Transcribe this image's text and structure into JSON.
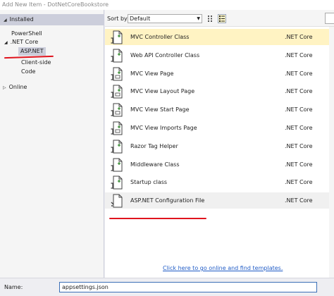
{
  "window": {
    "title": "Add New Item - DotNetCoreBookstore"
  },
  "tree": {
    "installed_label": "Installed",
    "items": [
      "PowerShell",
      ".NET Core",
      "ASP.NET",
      "Client-side",
      "Code"
    ],
    "online_label": "Online"
  },
  "toolbar": {
    "sort_by_label": "Sort by:",
    "sort_value": "Default"
  },
  "templates": [
    {
      "name": "MVC Controller Class",
      "lang": ".NET Core"
    },
    {
      "name": "Web API Controller Class",
      "lang": ".NET Core"
    },
    {
      "name": "MVC View Page",
      "lang": ".NET Core"
    },
    {
      "name": "MVC View Layout Page",
      "lang": ".NET Core"
    },
    {
      "name": "MVC View Start Page",
      "lang": ".NET Core"
    },
    {
      "name": "MVC View Imports Page",
      "lang": ".NET Core"
    },
    {
      "name": "Razor Tag Helper",
      "lang": ".NET Core"
    },
    {
      "name": "Middleware Class",
      "lang": ".NET Core"
    },
    {
      "name": "Startup class",
      "lang": ".NET Core"
    },
    {
      "name": "ASP.NET Configuration File",
      "lang": ".NET Core"
    }
  ],
  "online_link": "Click here to go online and find templates.",
  "name_field": {
    "label": "Name:",
    "value": "appsettings.json"
  },
  "colors": {
    "selection": "#fff3c3",
    "tree_selection": "#cccedb",
    "annotation": "#e0141e",
    "link": "#1f5bc6"
  },
  "icons": [
    "csharp-file-icon",
    "view-file-icon",
    "config-file-icon",
    "list-view-icon",
    "grid-view-icon"
  ]
}
